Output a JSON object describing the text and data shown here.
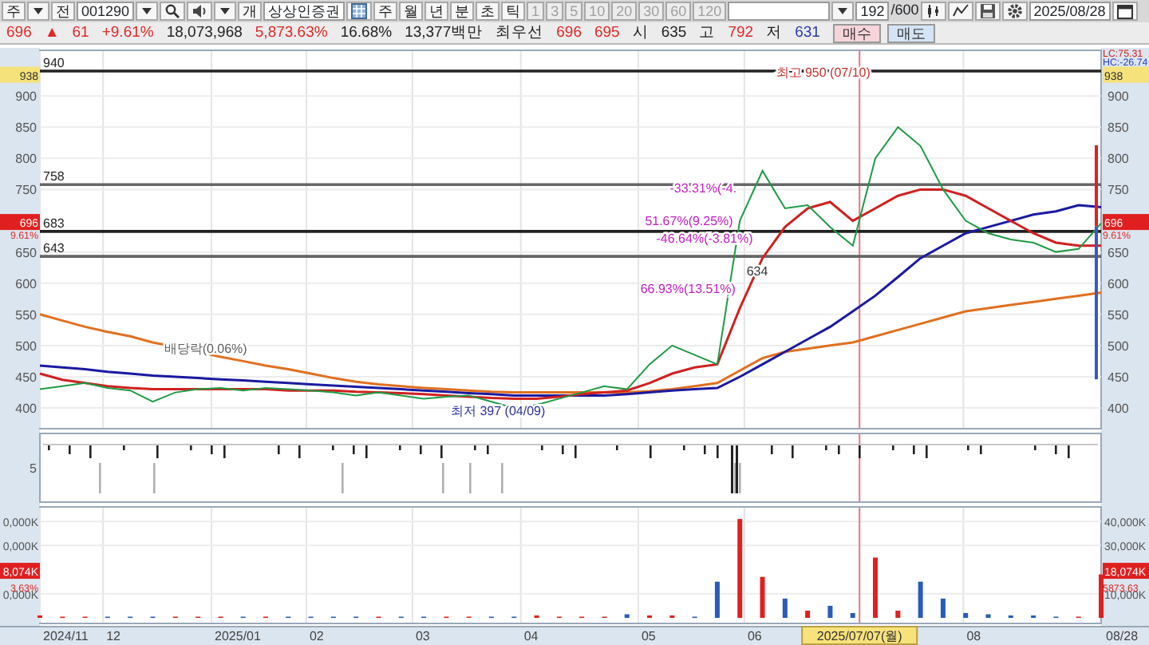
{
  "toolbar": {
    "items": [
      {
        "kind": "button",
        "text": "주",
        "disabled": false
      },
      {
        "kind": "caret"
      },
      {
        "kind": "button",
        "text": "전",
        "disabled": false
      },
      {
        "kind": "field",
        "text": "001290"
      },
      {
        "kind": "caret"
      },
      {
        "kind": "search"
      },
      {
        "kind": "speaker"
      },
      {
        "kind": "caret"
      },
      {
        "kind": "button",
        "text": "개",
        "disabled": false
      },
      {
        "kind": "name",
        "text": "상상인증권"
      },
      {
        "kind": "grid"
      },
      {
        "kind": "button",
        "text": "주",
        "disabled": false
      },
      {
        "kind": "button",
        "text": "월",
        "disabled": false
      },
      {
        "kind": "button",
        "text": "년",
        "disabled": false
      },
      {
        "kind": "button",
        "text": "분",
        "disabled": false
      },
      {
        "kind": "button",
        "text": "초",
        "disabled": false
      },
      {
        "kind": "button",
        "text": "틱",
        "disabled": false
      },
      {
        "kind": "button",
        "text": "1",
        "disabled": true
      },
      {
        "kind": "button",
        "text": "3",
        "disabled": true
      },
      {
        "kind": "button",
        "text": "5",
        "disabled": true
      },
      {
        "kind": "button",
        "text": "10",
        "disabled": true
      },
      {
        "kind": "button",
        "text": "20",
        "disabled": true
      },
      {
        "kind": "button",
        "text": "30",
        "disabled": true
      },
      {
        "kind": "button",
        "text": "60",
        "disabled": true
      },
      {
        "kind": "button",
        "text": "120",
        "disabled": true
      },
      {
        "kind": "blank"
      },
      {
        "kind": "caret"
      },
      {
        "kind": "field",
        "text": "192"
      },
      {
        "kind": "label",
        "text": "/600"
      },
      {
        "kind": "candle"
      },
      {
        "kind": "zigzag"
      },
      {
        "kind": "save"
      },
      {
        "kind": "settings"
      },
      {
        "kind": "field",
        "text": "2025/08/28"
      },
      {
        "kind": "calendar"
      }
    ]
  },
  "quote_bar": {
    "items": [
      {
        "kind": "quote",
        "text": "696",
        "color": "#e02828"
      },
      {
        "kind": "quote",
        "text": "▲",
        "color": "#e02828"
      },
      {
        "kind": "quote",
        "text": "61",
        "color": "#e02828"
      },
      {
        "kind": "quote",
        "text": "+9.61%",
        "color": "#e02828"
      },
      {
        "kind": "quote",
        "text": "18,073,968",
        "color": "#222222"
      },
      {
        "kind": "quote",
        "text": "5,873.63%",
        "color": "#e02828"
      },
      {
        "kind": "quote",
        "text": "16.68%",
        "color": "#222222"
      },
      {
        "kind": "quote",
        "text": "13,377백만",
        "color": "#222222"
      },
      {
        "kind": "quote",
        "text": "최우선",
        "color": "#222222"
      },
      {
        "kind": "quote",
        "text": "696",
        "color": "#e02828"
      },
      {
        "kind": "quote",
        "text": "695",
        "color": "#e02828"
      },
      {
        "kind": "quote",
        "text": "시",
        "color": "#222222"
      },
      {
        "kind": "quote",
        "text": "635",
        "color": "#222222"
      },
      {
        "kind": "quote",
        "text": "고",
        "color": "#222222"
      },
      {
        "kind": "quote",
        "text": "792",
        "color": "#e02828"
      },
      {
        "kind": "quote",
        "text": "저",
        "color": "#222222"
      },
      {
        "kind": "quote",
        "text": "631",
        "color": "#2a3aa8"
      },
      {
        "kind": "buy",
        "text": "매수"
      },
      {
        "kind": "sell",
        "text": "매도"
      }
    ]
  },
  "price_panel": {
    "chart_data": {
      "type": "line",
      "series": [
        {
          "color": "#1f9a45",
          "values": [
            430,
            435,
            440,
            432,
            428,
            410,
            425,
            430,
            432,
            428,
            432,
            430,
            428,
            425,
            420,
            425,
            420,
            415,
            418,
            420,
            410,
            400,
            405,
            415,
            425,
            435,
            430,
            470,
            500,
            485,
            470,
            700,
            780,
            720,
            725,
            690,
            660,
            800,
            850,
            820,
            750,
            700,
            680,
            670,
            665,
            650,
            655,
            696
          ]
        },
        {
          "color": "#d02020",
          "values": [
            455,
            445,
            440,
            435,
            432,
            430,
            430,
            430,
            430,
            430,
            430,
            428,
            428,
            428,
            426,
            425,
            424,
            422,
            420,
            418,
            416,
            415,
            415,
            418,
            422,
            425,
            428,
            440,
            455,
            465,
            470,
            560,
            640,
            690,
            720,
            730,
            700,
            720,
            740,
            750,
            750,
            740,
            720,
            700,
            680,
            665,
            660,
            660
          ]
        },
        {
          "color": "#1a1aa0",
          "values": [
            468,
            465,
            462,
            458,
            455,
            452,
            450,
            448,
            446,
            444,
            442,
            440,
            438,
            436,
            434,
            432,
            430,
            428,
            426,
            424,
            422,
            420,
            420,
            420,
            420,
            420,
            422,
            425,
            428,
            430,
            432,
            450,
            470,
            490,
            510,
            530,
            555,
            580,
            610,
            640,
            660,
            680,
            690,
            700,
            710,
            715,
            725,
            722
          ]
        },
        {
          "color": "#e07020",
          "values": [
            550,
            540,
            530,
            522,
            515,
            505,
            498,
            490,
            482,
            475,
            468,
            462,
            455,
            448,
            442,
            438,
            435,
            432,
            430,
            428,
            426,
            425,
            425,
            425,
            425,
            425,
            425,
            427,
            430,
            435,
            440,
            460,
            480,
            490,
            495,
            500,
            505,
            515,
            525,
            535,
            545,
            555,
            560,
            565,
            570,
            575,
            580,
            585
          ]
        }
      ],
      "ylim": [
        363,
        977
      ],
      "grid": true,
      "ref_lines": [
        {
          "axis": "y",
          "value": 940,
          "label": "940",
          "color": "#222222"
        },
        {
          "axis": "y",
          "value": 758,
          "label": "758",
          "color": "#666666"
        },
        {
          "axis": "y",
          "value": 683,
          "label": "683",
          "color": "#222222"
        },
        {
          "axis": "y",
          "value": 643,
          "label": "643",
          "color": "#666666"
        }
      ],
      "yticks": [
        400,
        450,
        500,
        550,
        600,
        650,
        750,
        800,
        850,
        900
      ]
    },
    "right_axis_labels": [
      "900",
      "850",
      "800",
      "750",
      "650",
      "600",
      "550",
      "500",
      "450",
      "400"
    ],
    "notes": [
      {
        "text": "최고 950 (07/10)",
        "color": "#c83030"
      },
      {
        "text": "최저 397 (04/09)",
        "color": "#2a30a0"
      },
      {
        "text": "배당락(0.06%)",
        "color": "#606060"
      },
      {
        "text": "-33.31%(-4.",
        "color": "#c020c0"
      },
      {
        "text": "51.67%(9.25%)",
        "color": "#c020c0"
      },
      {
        "text": "-46.64%(-3.81%)",
        "color": "#c020c0"
      },
      {
        "text": "66.93%(13.51%)",
        "color": "#c020c0"
      },
      {
        "text": "634",
        "color": "#333333"
      }
    ],
    "left_tags": [
      {
        "text": "938",
        "color": "#f6e27a"
      },
      {
        "text": "696",
        "color": "#e02020"
      }
    ],
    "left_notes": [
      {
        "text": "9.61%",
        "color": "#e02828"
      }
    ],
    "right_tags": [
      {
        "text": "938",
        "color": "#f6e27a"
      },
      {
        "text": "696",
        "color": "#e02020"
      }
    ],
    "right_notes": [
      {
        "text": "LC:75.31",
        "color": "#d02020"
      },
      {
        "text": "HC:-26.74",
        "color": "#2a40c0"
      },
      {
        "text": "9.61%",
        "color": "#e02828"
      }
    ]
  },
  "indicator_panel": {
    "axis_label": "5"
  },
  "volume_panel": {
    "chart_data": {
      "type": "bar",
      "values": [
        1000,
        500,
        500,
        500,
        500,
        500,
        500,
        500,
        500,
        500,
        500,
        500,
        500,
        500,
        500,
        500,
        500,
        500,
        500,
        500,
        500,
        500,
        1000,
        500,
        500,
        500,
        1500,
        1000,
        1000,
        500,
        15000,
        41000,
        17000,
        8000,
        3000,
        5000,
        2000,
        25000,
        3000,
        15000,
        8000,
        2000,
        1500,
        1000,
        1000,
        500,
        500,
        18000
      ],
      "ylim": [
        0,
        47000
      ],
      "grid": true,
      "yticks": [
        {
          "value": 10000,
          "label": "10,000K"
        },
        {
          "value": 30000,
          "label": "30,000K"
        },
        {
          "value": 40000,
          "label": "40,000K"
        }
      ]
    },
    "left_axis_labels": [
      "0,000K",
      "0,000K",
      "0,000K"
    ],
    "left_tags": [
      {
        "text": "8,074K",
        "color": "#e02020"
      }
    ],
    "left_notes": [
      {
        "text": "3.63%",
        "color": "#e02828"
      }
    ],
    "right_tags": [
      {
        "text": "18,074K",
        "color": "#e02020"
      }
    ],
    "right_notes": [
      {
        "text": "5873.63",
        "color": "#e02828"
      }
    ]
  },
  "date_axis": {
    "labels": [
      "2024/11",
      "12",
      "2025/01",
      "02",
      "03",
      "04",
      "05",
      "06",
      "08",
      "08/28"
    ],
    "cursor": {
      "label": "2025/07/07(월)"
    }
  }
}
